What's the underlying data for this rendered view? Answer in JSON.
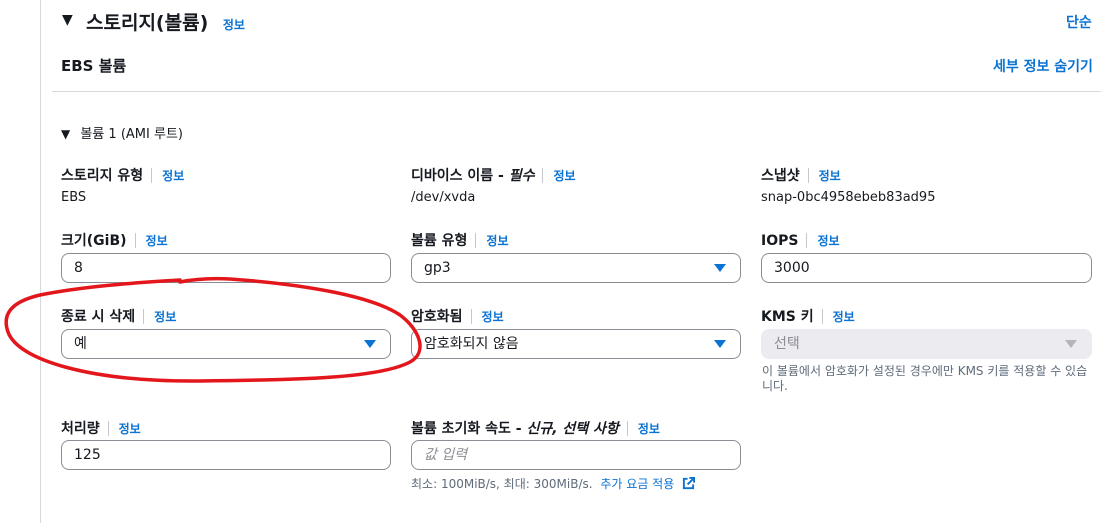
{
  "header": {
    "title": "스토리지(볼륨)",
    "info_label": "정보",
    "simple_link": "단순",
    "subtitle": "EBS 볼륨",
    "hide_details_link": "세부 정보 숨기기"
  },
  "volume": {
    "label": "볼륨 1 (AMI 루트)"
  },
  "fields": {
    "storage_type": {
      "label": "스토리지 유형",
      "info": "정보",
      "value": "EBS"
    },
    "device_name": {
      "label": "디바이스 이름 - ",
      "label_em": "필수",
      "info": "정보",
      "value": "/dev/xvda"
    },
    "snapshot": {
      "label": "스냅샷",
      "info": "정보",
      "value": "snap-0bc4958ebeb83ad95"
    },
    "size": {
      "label": "크기(GiB)",
      "info": "정보",
      "value": "8"
    },
    "volume_type": {
      "label": "볼륨 유형",
      "info": "정보",
      "value": "gp3"
    },
    "iops": {
      "label": "IOPS",
      "info": "정보",
      "value": "3000"
    },
    "delete_on_termination": {
      "label": "종료 시 삭제",
      "info": "정보",
      "value": "예"
    },
    "encrypted": {
      "label": "암호화됨",
      "info": "정보",
      "value": "암호화되지 않음"
    },
    "kms_key": {
      "label": "KMS 키",
      "info": "정보",
      "value": "선택",
      "hint": "이 볼륨에서 암호화가 설정된 경우에만 KMS 키를 적용할 수 있습니다."
    },
    "throughput": {
      "label": "처리량",
      "info": "정보",
      "value": "125"
    },
    "init_rate": {
      "label": "볼륨 초기화 속도 - ",
      "label_em": "신규, 선택 사항",
      "info": "정보",
      "placeholder": "값 입력",
      "hint": "최소: 100MiB/s, 최대: 300MiB/s.",
      "hint_link": "추가 요금 적용"
    }
  },
  "annotation": {
    "color": "#e3161b"
  },
  "colors": {
    "link": "#0972d3",
    "text": "#16191f",
    "border": "#8c8c94"
  }
}
